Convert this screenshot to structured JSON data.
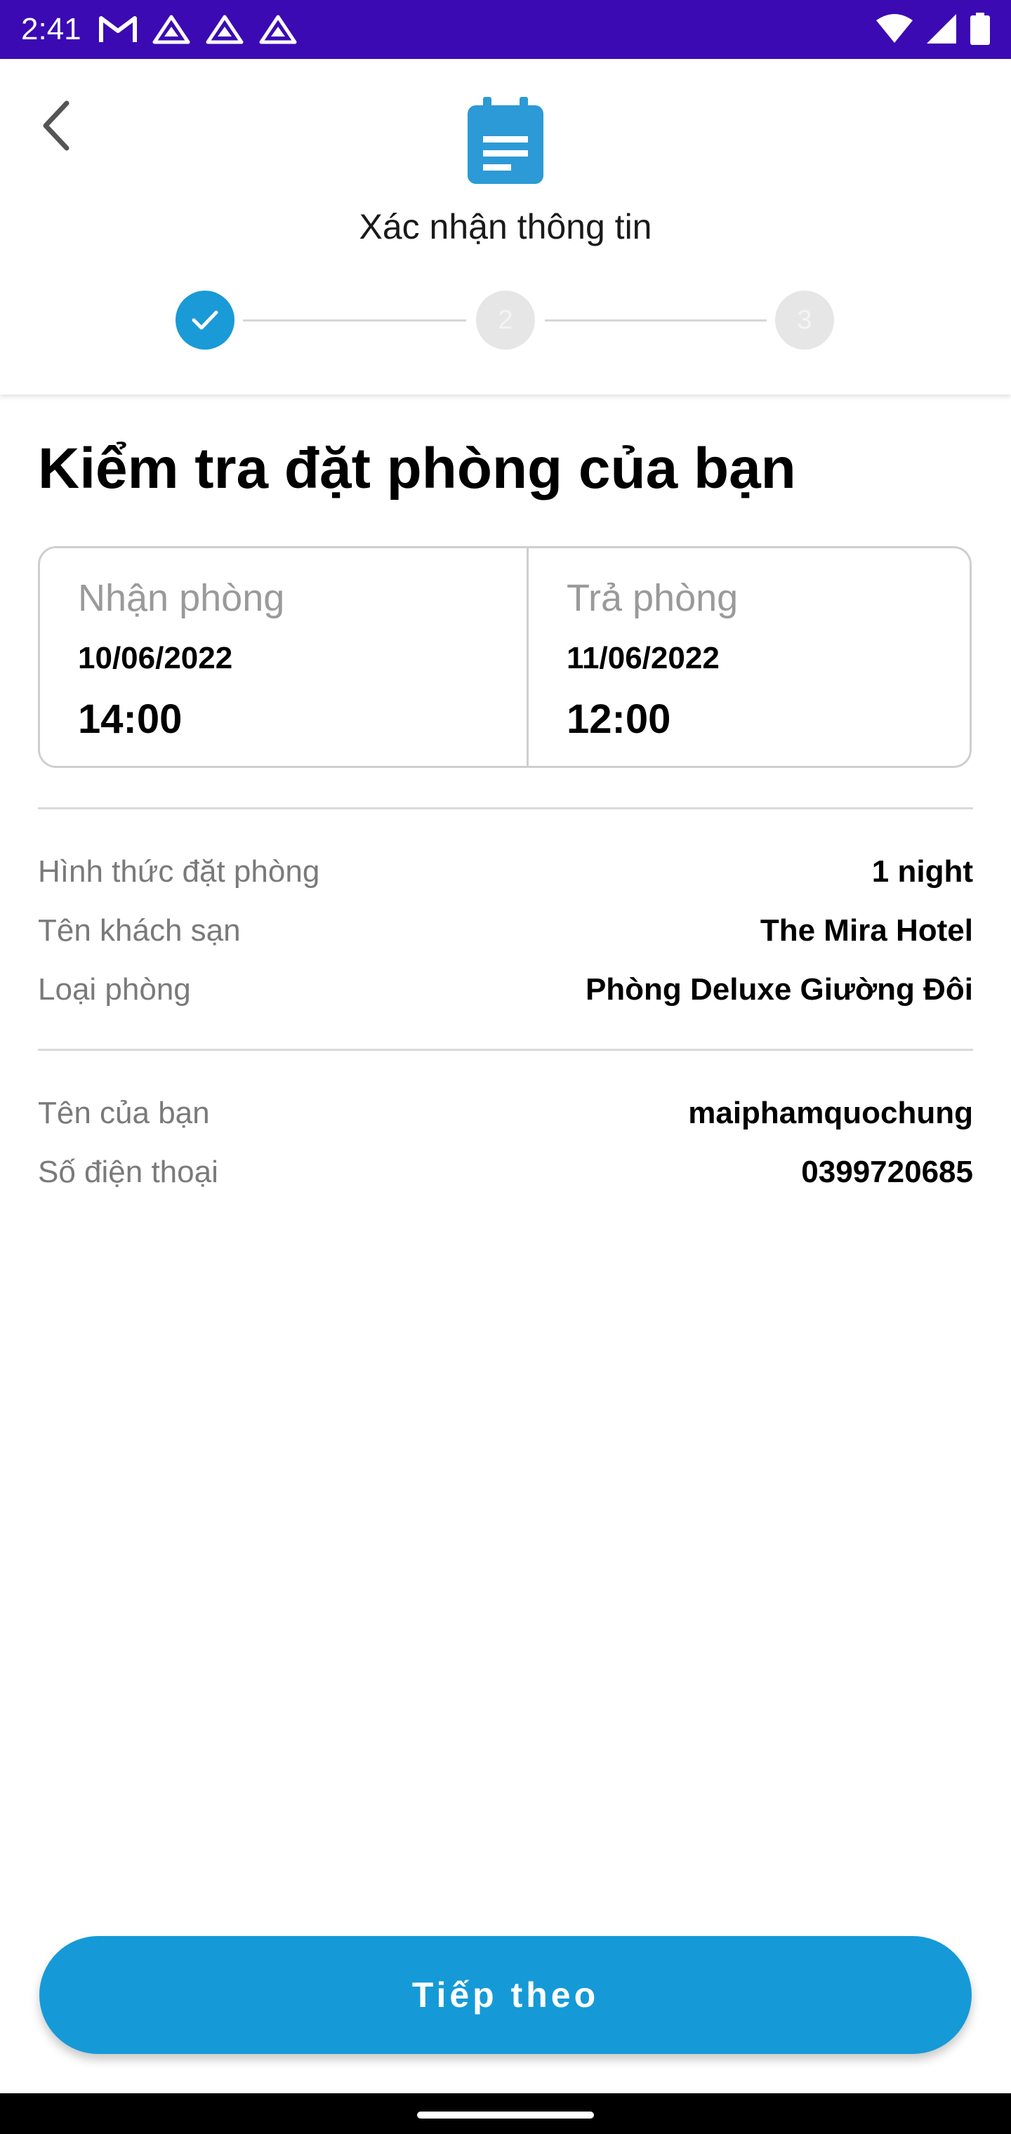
{
  "status_bar": {
    "time": "2:41",
    "left_icons": [
      "gmail-icon",
      "drive-icon",
      "drive-icon",
      "drive-icon"
    ],
    "right_icons": [
      "wifi-icon",
      "signal-icon",
      "battery-icon"
    ],
    "background_color": "#3b0ab3"
  },
  "header": {
    "title": "Xác nhận thông tin",
    "icon": "calendar-icon",
    "back_icon": "chevron-left-icon",
    "steps": [
      {
        "label": "",
        "state": "completed"
      },
      {
        "label": "2",
        "state": "inactive"
      },
      {
        "label": "3",
        "state": "inactive"
      }
    ],
    "accent_color": "#1a9ad6"
  },
  "main": {
    "heading": "Kiểm tra đặt phòng của bạn",
    "check_in": {
      "label": "Nhận phòng",
      "date": "10/06/2022",
      "time": "14:00"
    },
    "check_out": {
      "label": "Trả phòng",
      "date": "11/06/2022",
      "time": "12:00"
    },
    "booking_details": [
      {
        "label": "Hình thức đặt phòng",
        "value": "1 night"
      },
      {
        "label": "Tên khách sạn",
        "value": "The Mira Hotel"
      },
      {
        "label": "Loại phòng",
        "value": "Phòng Deluxe Giường Đôi"
      }
    ],
    "guest_details": [
      {
        "label": "Tên của bạn",
        "value": "maiphamquochung"
      },
      {
        "label": "Số điện thoại",
        "value": "0399720685"
      }
    ]
  },
  "footer": {
    "next_label": "Tiếp theo",
    "button_color": "#159ad7"
  }
}
